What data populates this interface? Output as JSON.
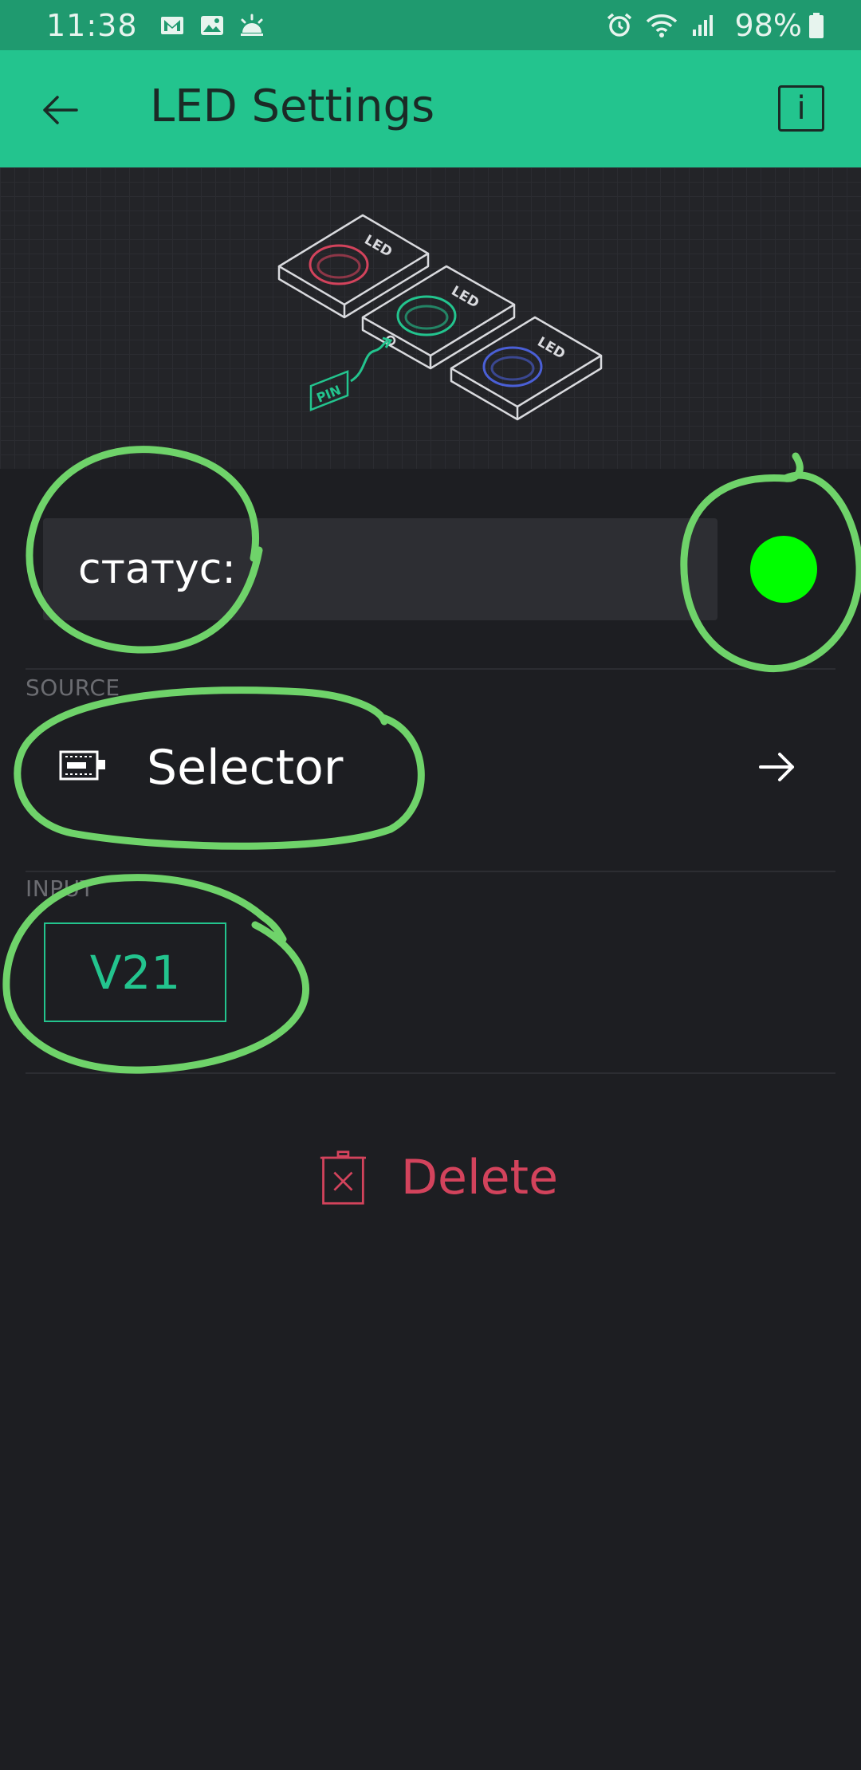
{
  "status_bar": {
    "time": "11:38",
    "battery": "98%",
    "left_icons": [
      "gmail-icon",
      "gallery-icon",
      "weather-icon"
    ],
    "right_icons": [
      "alarm-icon",
      "wifi-icon",
      "signal-icon",
      "battery-icon"
    ]
  },
  "app_bar": {
    "title": "LED Settings",
    "back_icon": "arrow-left-icon",
    "info_icon": "info-icon",
    "info_glyph": "i"
  },
  "illustration": {
    "led_labels": [
      "LED",
      "LED",
      "LED"
    ],
    "pin_label": "PIN"
  },
  "widget": {
    "name": "статус:",
    "color": "#00ff00"
  },
  "source": {
    "section_label": "SOURCE",
    "device_name": "Selector"
  },
  "input": {
    "section_label": "INPUT",
    "pin": "V21"
  },
  "actions": {
    "delete_label": "Delete"
  },
  "colors": {
    "accent": "#23c48e",
    "status_bar": "#1f9a6f",
    "background": "#1d1e22",
    "delete": "#d3435c",
    "annotation": "#6fd36a"
  }
}
